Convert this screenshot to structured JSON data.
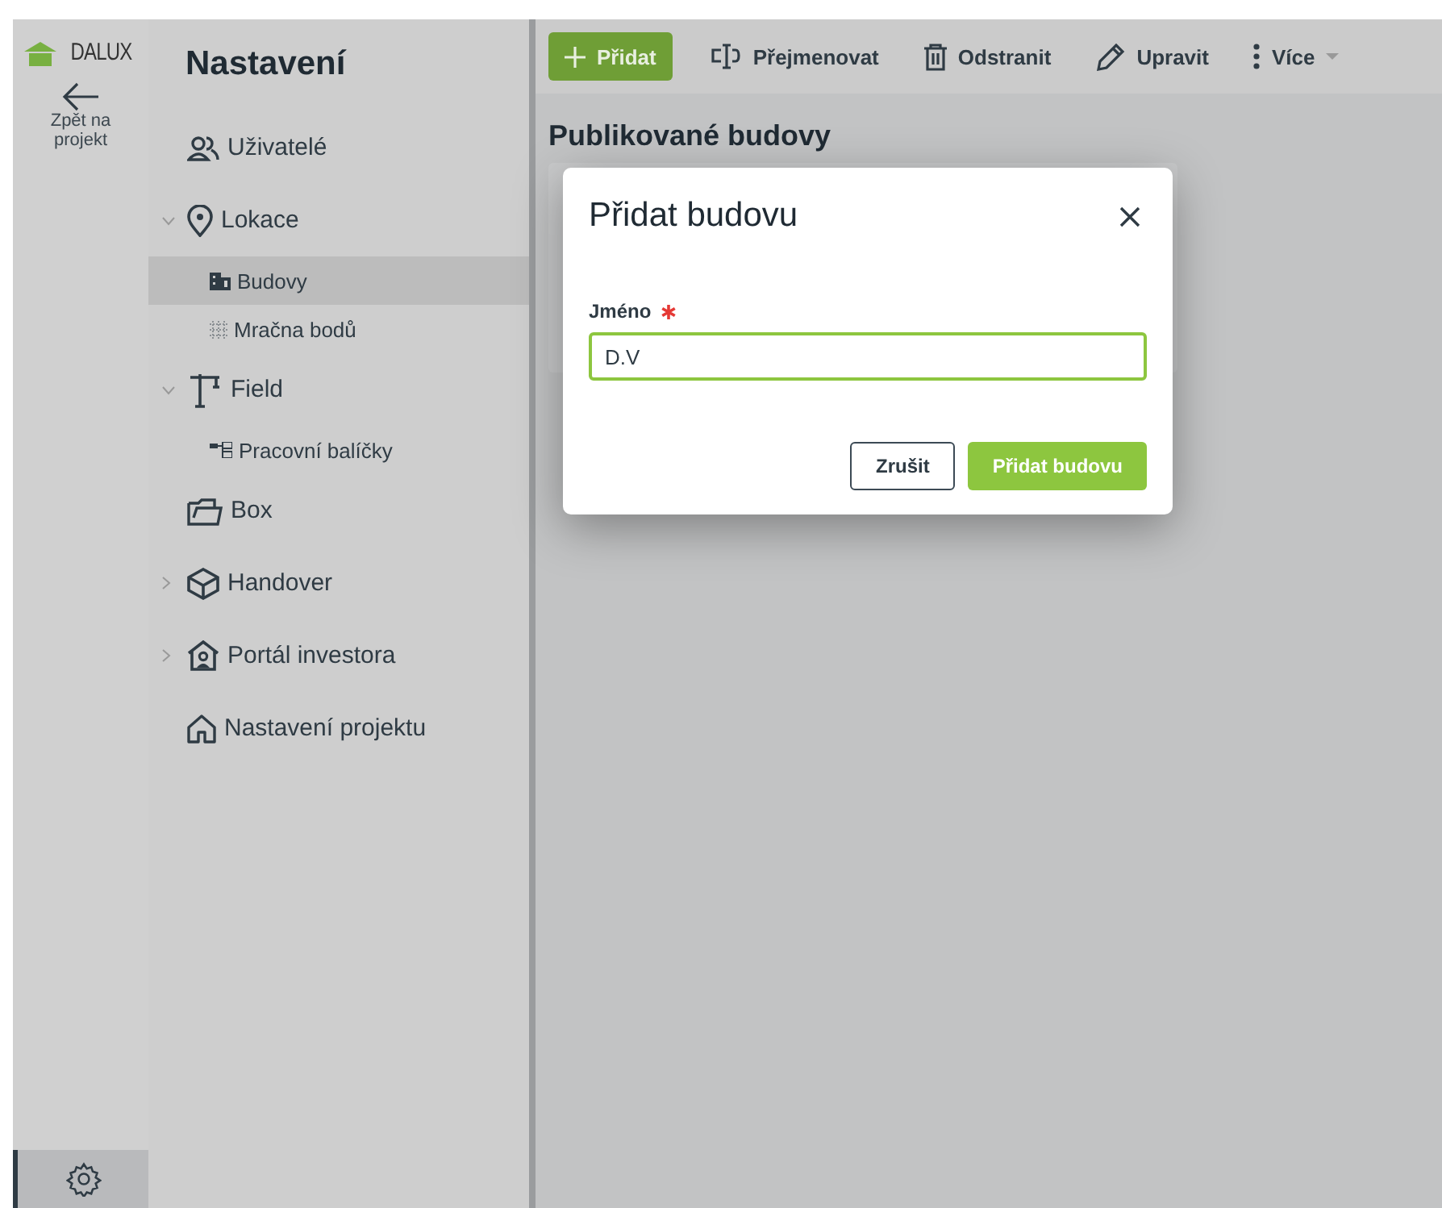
{
  "brand": {
    "name": "DALUX"
  },
  "back": {
    "label": "Zpět na projekt"
  },
  "rail_bottom": {
    "selected": true
  },
  "sidebar": {
    "title": "Nastavení",
    "items": [
      {
        "label": "Uživatelé",
        "selected": false
      },
      {
        "label": "Lokace",
        "selected": false,
        "expanded": true,
        "children": [
          {
            "label": "Budovy",
            "selected": true
          },
          {
            "label": "Mračna bodů",
            "selected": false
          }
        ]
      },
      {
        "label": "Field",
        "selected": false,
        "expanded": true,
        "children": [
          {
            "label": "Pracovní balíčky",
            "selected": false
          }
        ]
      },
      {
        "label": "Box",
        "selected": false
      },
      {
        "label": "Handover",
        "selected": false,
        "expanded": false
      },
      {
        "label": "Portál investora",
        "selected": false,
        "expanded": false
      },
      {
        "label": "Nastavení projektu",
        "selected": false
      }
    ]
  },
  "toolbar": [
    {
      "label": "Přidat",
      "kind": "primary"
    },
    {
      "label": "Přejmenovat",
      "kind": "rename"
    },
    {
      "label": "Odstranit",
      "kind": "delete"
    },
    {
      "label": "Upravit",
      "kind": "edit"
    },
    {
      "label": "Více",
      "kind": "more"
    }
  ],
  "main": {
    "heading": "Publikované budovy"
  },
  "dialog": {
    "title": "Přidat budovu",
    "field_label": "Jméno",
    "required": true,
    "value": "D.V",
    "buttons": [
      {
        "label": "Zrušit",
        "kind": "secondary"
      },
      {
        "label": "Přidat budovu",
        "kind": "primary"
      }
    ]
  }
}
